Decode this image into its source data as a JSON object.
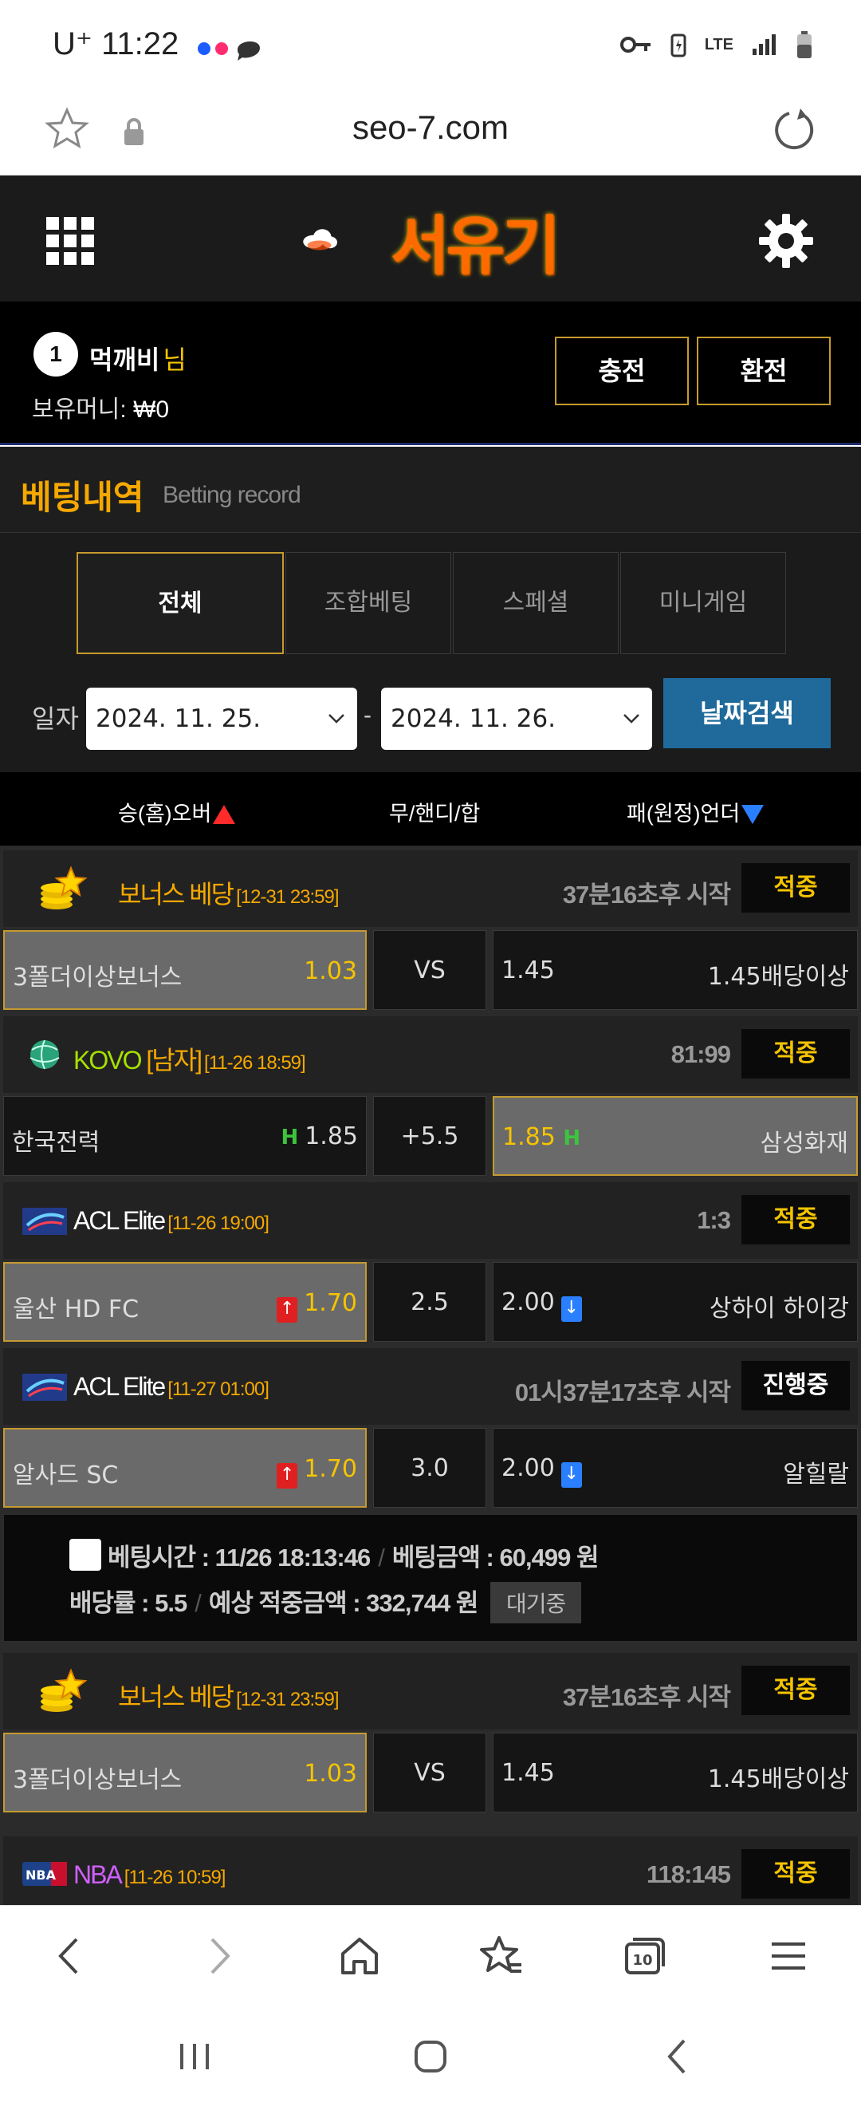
{
  "status_bar": {
    "carrier": "U⁺",
    "time": "11:22",
    "network": "LTE"
  },
  "browser": {
    "url": "seo-7.com"
  },
  "site": {
    "logo_text": "서유기"
  },
  "user": {
    "level": "1",
    "name": "먹깨비",
    "suffix": "님",
    "money_label": "보유머니:",
    "money_value": "₩0",
    "charge_label": "충전",
    "exchange_label": "환전"
  },
  "section": {
    "title_ko": "베팅내역",
    "title_en": "Betting record"
  },
  "tabs": [
    {
      "label": "전체",
      "active": true
    },
    {
      "label": "조합베팅",
      "active": false
    },
    {
      "label": "스페셜",
      "active": false
    },
    {
      "label": "미니게임",
      "active": false
    }
  ],
  "date_filter": {
    "label": "일자",
    "from": "2024. 11. 25.",
    "separator": "-",
    "to": "2024. 11. 26.",
    "search_label": "날짜검색"
  },
  "columns": {
    "home": "승(홈)오버",
    "draw": "무/핸디/합",
    "away": "패(원정)언더"
  },
  "bets": [
    {
      "league": "보너스 베당",
      "league_color": "#f5a800",
      "time": "[12-31 23:59]",
      "info": "37분16초후 시작",
      "status": "적중",
      "home": "3폴더이상보너스",
      "home_odd": "1.03",
      "mid": "VS",
      "away_odd": "1.45",
      "away": "1.45배당이상"
    },
    {
      "league": "KOVO",
      "league_sub": "[남자]",
      "league_color": "#a6e000",
      "time": "[11-26 18:59]",
      "info": "81:99",
      "status": "적중",
      "home": "한국전력",
      "home_odd": "1.85",
      "mid": "+5.5",
      "away_odd": "1.85",
      "away": "삼성화재"
    },
    {
      "league": "ACL Elite",
      "league_color": "#ffffff",
      "time": "[11-26 19:00]",
      "info": "1:3",
      "status": "적중",
      "home": "울산 HD FC",
      "home_odd": "1.70",
      "mid": "2.5",
      "away_odd": "2.00",
      "away": "상하이 하이강"
    },
    {
      "league": "ACL Elite",
      "league_color": "#ffffff",
      "time": "[11-27 01:00]",
      "info": "01시37분17초후 시작",
      "status": "진행중",
      "home": "알사드 SC",
      "home_odd": "1.70",
      "mid": "3.0",
      "away_odd": "2.00",
      "away": "알힐랄"
    },
    {
      "league": "보너스 베당",
      "league_color": "#f5a800",
      "time": "[12-31 23:59]",
      "info": "37분16초후 시작",
      "status": "적중",
      "home": "3폴더이상보너스",
      "home_odd": "1.03",
      "mid": "VS",
      "away_odd": "1.45",
      "away": "1.45배당이상"
    },
    {
      "league": "NBA",
      "league_color": "#d060ff",
      "time": "[11-26 10:59]",
      "info": "118:145",
      "status": "적중"
    }
  ],
  "summary": {
    "bet_time_label": "베팅시간 :",
    "bet_time": "11/26 18:13:46",
    "bet_amount_label": "베팅금액 :",
    "bet_amount": "60,499 원",
    "odds_label": "배당률 :",
    "odds": "5.5",
    "expected_label": "예상 적중금액 :",
    "expected": "332,744 원",
    "state": "대기중"
  },
  "browser_nav": {
    "tab_count": "10"
  }
}
